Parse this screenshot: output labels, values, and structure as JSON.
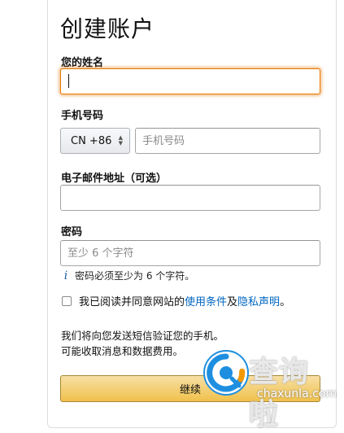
{
  "form": {
    "title": "创建账户",
    "name_label": "您的姓名",
    "name_value": "",
    "phone_label": "手机号码",
    "country_code": "CN +86",
    "phone_placeholder": "手机号码",
    "email_label": "电子邮件地址（可选）",
    "email_value": "",
    "password_label": "密码",
    "password_placeholder": "至少 6 个字符",
    "password_hint": "密码必须至少为 6 个字符。",
    "agree_prefix": "我已阅读并同意网站的",
    "agree_terms_link": "使用条件",
    "agree_and": "及",
    "agree_privacy_link": "隐私声明",
    "agree_suffix": "。",
    "sms_notice_line1": "我们将向您发送短信验证您的手机。",
    "sms_notice_line2": "可能收取消息和数据费用。",
    "continue_label": "继续"
  },
  "watermark": {
    "cn": "查询啦",
    "en": "chaxunla.com",
    "colors": {
      "blue": "#1e8fe0",
      "orange": "#f39800"
    }
  },
  "colors": {
    "focus_orange": "#e77600",
    "link_blue": "#0066c0",
    "button_yellow": "#f0c14b"
  }
}
